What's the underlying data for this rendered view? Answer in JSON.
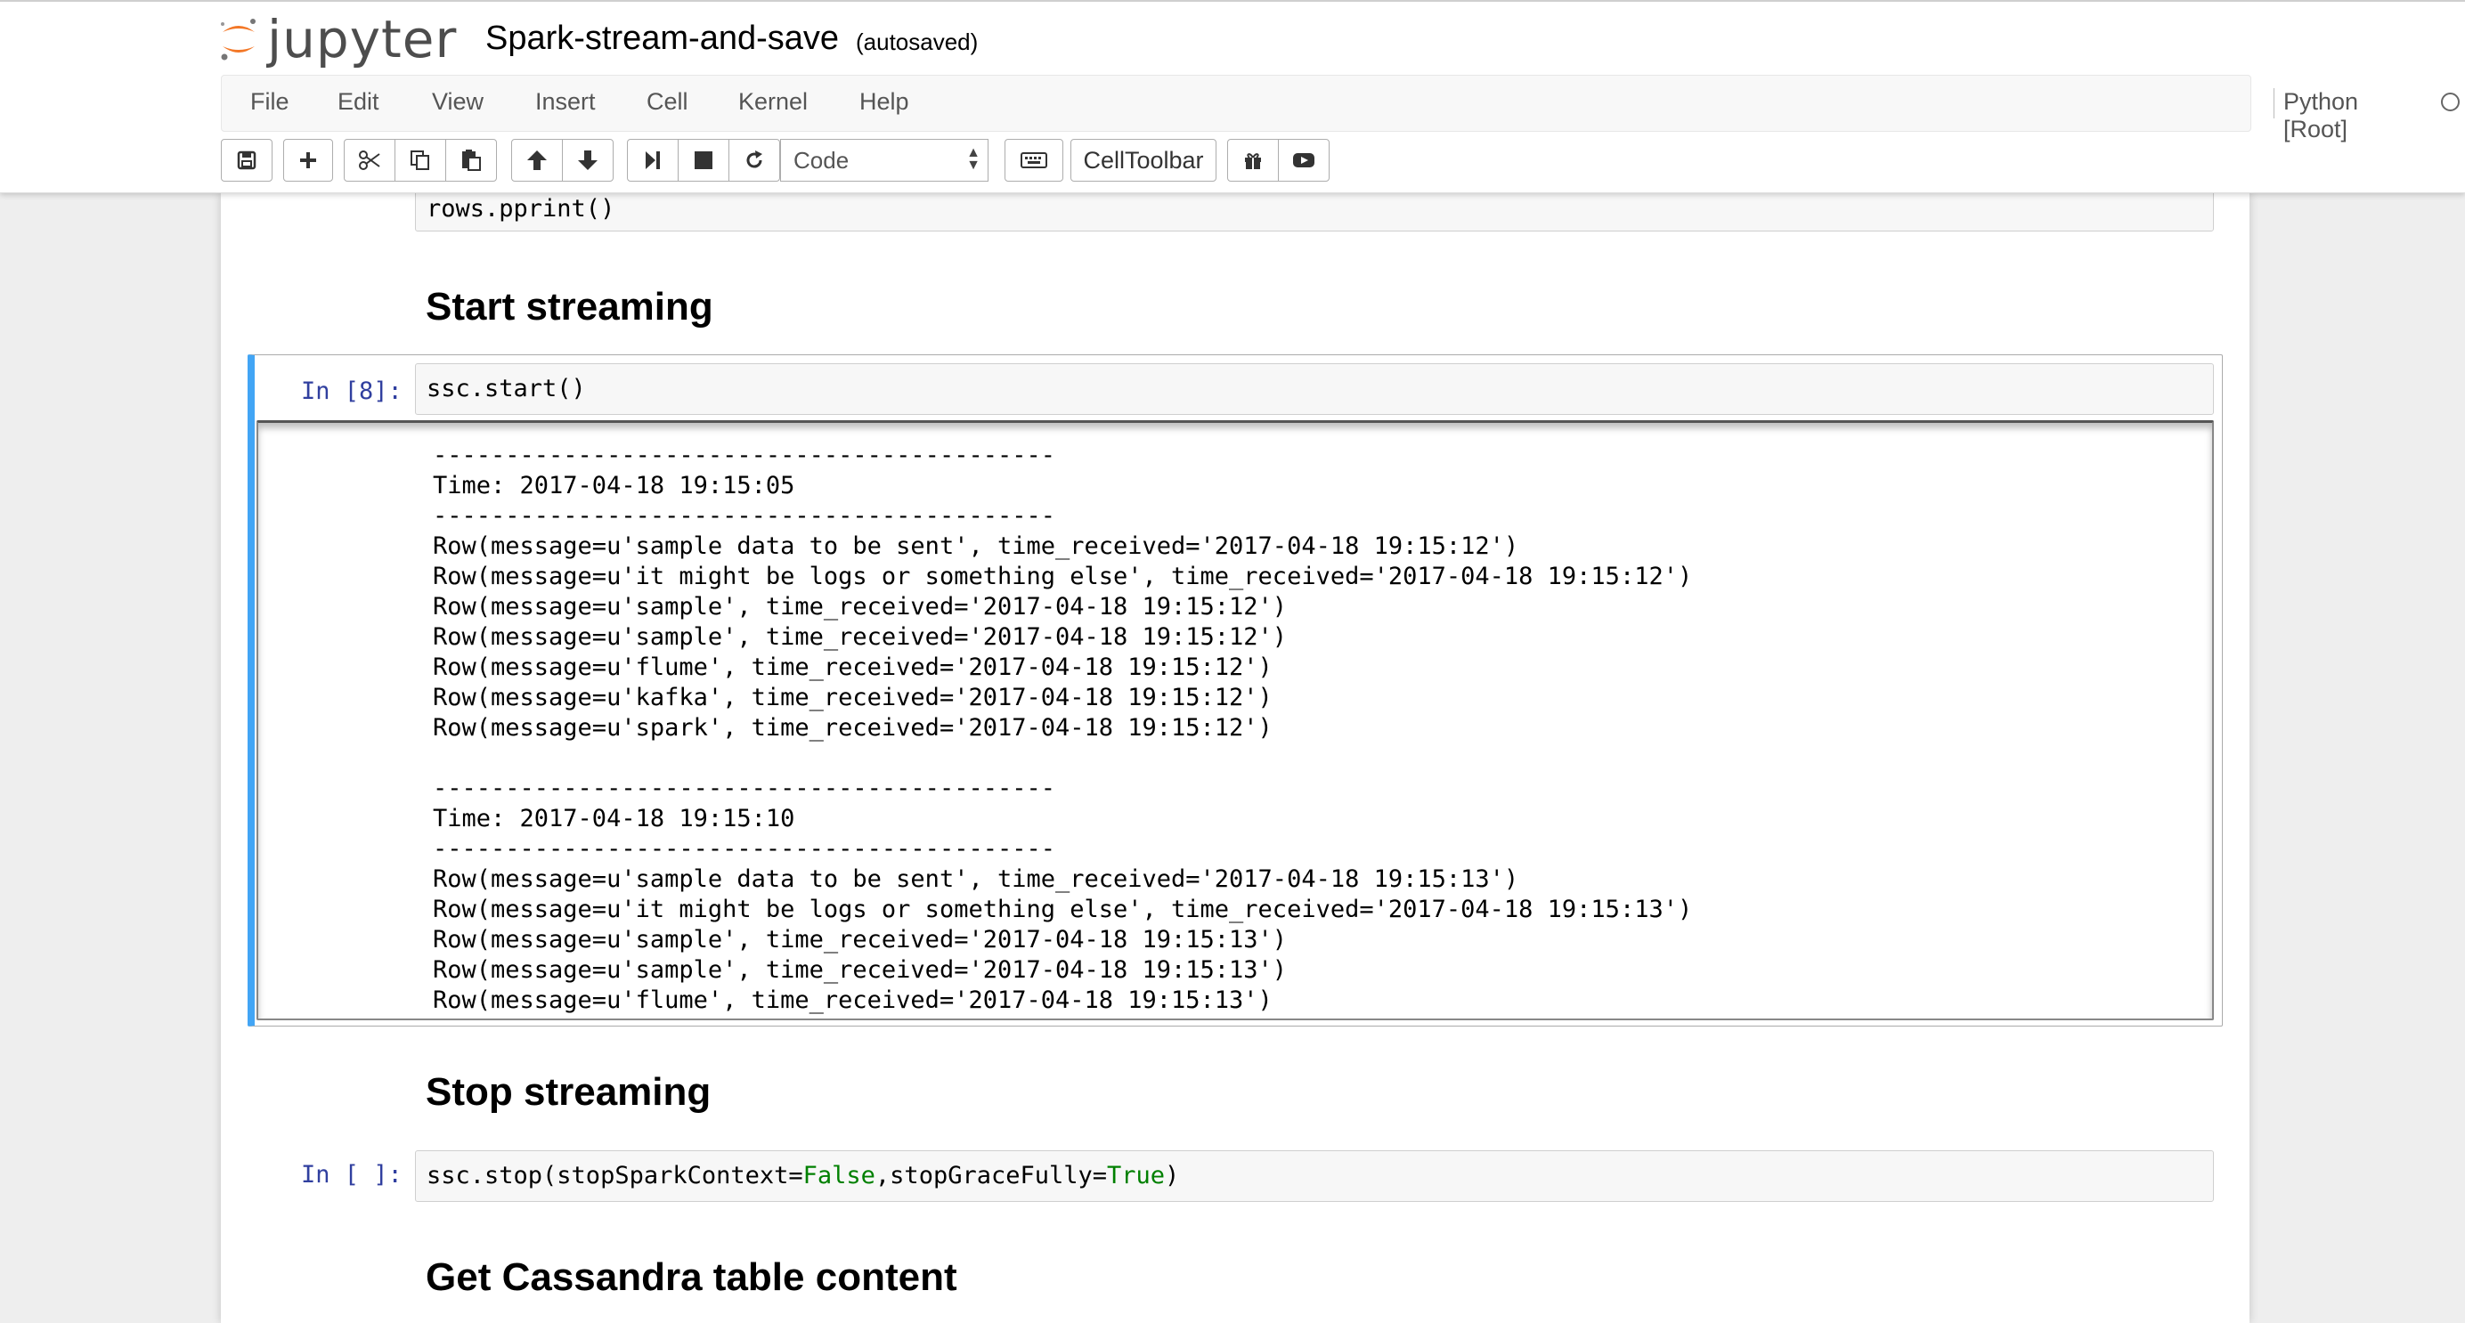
{
  "header": {
    "logo_text": "jupyter",
    "notebook_title": "Spark-stream-and-save",
    "autosave_status": "(autosaved)"
  },
  "menubar": {
    "items": [
      "File",
      "Edit",
      "View",
      "Insert",
      "Cell",
      "Kernel",
      "Help"
    ],
    "kernel_name": "Python [Root]"
  },
  "toolbar": {
    "icons": [
      "save-icon",
      "plus-icon",
      "cut-icon",
      "copy-icon",
      "paste-icon",
      "arrow-up-icon",
      "arrow-down-icon",
      "run-step-icon",
      "stop-icon",
      "restart-icon",
      "keyboard-icon",
      "gift-icon",
      "youtube-icon"
    ],
    "cell_type": "Code",
    "celltoolbar_label": "CellToolbar"
  },
  "notebook": {
    "prev_cell_code": "rows.pprint()",
    "heading_start": "Start streaming",
    "cell8": {
      "prompt": "In [8]:",
      "code": "ssc.start()",
      "output_lines": [
        "-------------------------------------------",
        "Time: 2017-04-18 19:15:05",
        "-------------------------------------------",
        "Row(message=u'sample data to be sent', time_received='2017-04-18 19:15:12')",
        "Row(message=u'it might be logs or something else', time_received='2017-04-18 19:15:12')",
        "Row(message=u'sample', time_received='2017-04-18 19:15:12')",
        "Row(message=u'sample', time_received='2017-04-18 19:15:12')",
        "Row(message=u'flume', time_received='2017-04-18 19:15:12')",
        "Row(message=u'kafka', time_received='2017-04-18 19:15:12')",
        "Row(message=u'spark', time_received='2017-04-18 19:15:12')",
        "",
        "-------------------------------------------",
        "Time: 2017-04-18 19:15:10",
        "-------------------------------------------",
        "Row(message=u'sample data to be sent', time_received='2017-04-18 19:15:13')",
        "Row(message=u'it might be logs or something else', time_received='2017-04-18 19:15:13')",
        "Row(message=u'sample', time_received='2017-04-18 19:15:13')",
        "Row(message=u'sample', time_received='2017-04-18 19:15:13')",
        "Row(message=u'flume', time_received='2017-04-18 19:15:13')"
      ]
    },
    "heading_stop": "Stop streaming",
    "stop_cell": {
      "prompt": "In [ ]:",
      "code_prefix": "ssc.stop(stopSparkContext=",
      "false_kw": "False",
      "code_middle": ",stopGraceFully=",
      "true_kw": "True",
      "code_suffix": ")"
    },
    "heading_cassandra": "Get Cassandra table content"
  },
  "colors": {
    "selected_cell_bar": "#42a5f5",
    "prompt_blue": "#303f9f",
    "keyword_green": "#008000",
    "logo_orange": "#f37726"
  }
}
